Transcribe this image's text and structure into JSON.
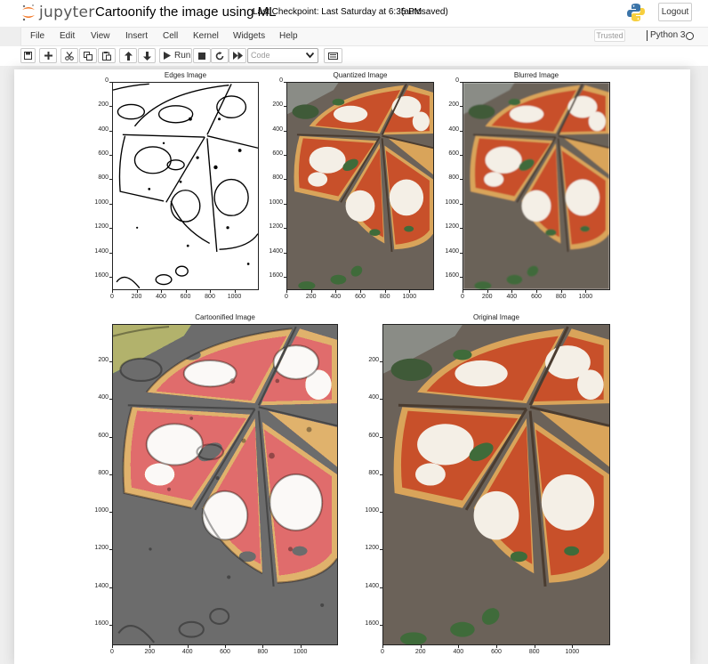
{
  "header": {
    "logo_text": "jupyter",
    "notebook_title": "Cartoonify the image using ML",
    "checkpoint": "Last Checkpoint: Last Saturday at 6:35 PM",
    "autosave": "(autosaved)",
    "logout_label": "Logout"
  },
  "menu": [
    "File",
    "Edit",
    "View",
    "Insert",
    "Cell",
    "Kernel",
    "Widgets",
    "Help"
  ],
  "kernel": {
    "trusted_label": "Trusted",
    "name": "Python 3"
  },
  "toolbar": {
    "run_label": "Run",
    "cell_type": "Code"
  },
  "figures": [
    {
      "title": "Edges Image",
      "style": "edges",
      "yticks": [
        "0",
        "200",
        "400",
        "600",
        "800",
        "1000",
        "1200",
        "1400",
        "1600"
      ],
      "xticks": [
        "0",
        "200",
        "400",
        "600",
        "800",
        "1000"
      ]
    },
    {
      "title": "Quantized Image",
      "style": "photo",
      "yticks": [
        "0",
        "200",
        "400",
        "600",
        "800",
        "1000",
        "1200",
        "1400",
        "1600"
      ],
      "xticks": [
        "0",
        "200",
        "400",
        "600",
        "800",
        "1000"
      ]
    },
    {
      "title": "Blurred Image",
      "style": "photo",
      "yticks": [
        "0",
        "200",
        "400",
        "600",
        "800",
        "1000",
        "1200",
        "1400",
        "1600"
      ],
      "xticks": [
        "0",
        "200",
        "400",
        "600",
        "800",
        "1000"
      ]
    },
    {
      "title": "Cartoonified Image",
      "style": "cartoon",
      "yticks": [
        "200",
        "400",
        "600",
        "800",
        "1000",
        "1200",
        "1400",
        "1600"
      ],
      "xticks": [
        "0",
        "200",
        "400",
        "600",
        "800",
        "1000"
      ]
    },
    {
      "title": "Original Image",
      "style": "original",
      "yticks": [
        "200",
        "400",
        "600",
        "800",
        "1000",
        "1200",
        "1400",
        "1600"
      ],
      "xticks": [
        "0",
        "200",
        "400",
        "600",
        "800",
        "1000"
      ]
    }
  ],
  "image": {
    "width": 1200,
    "height": 1710
  },
  "colors": {
    "crust": "#d9a45a",
    "sauce": "#c8502a",
    "cheese": "#f4efe6",
    "basil": "#3f6b3a",
    "board": "#6b6259"
  }
}
